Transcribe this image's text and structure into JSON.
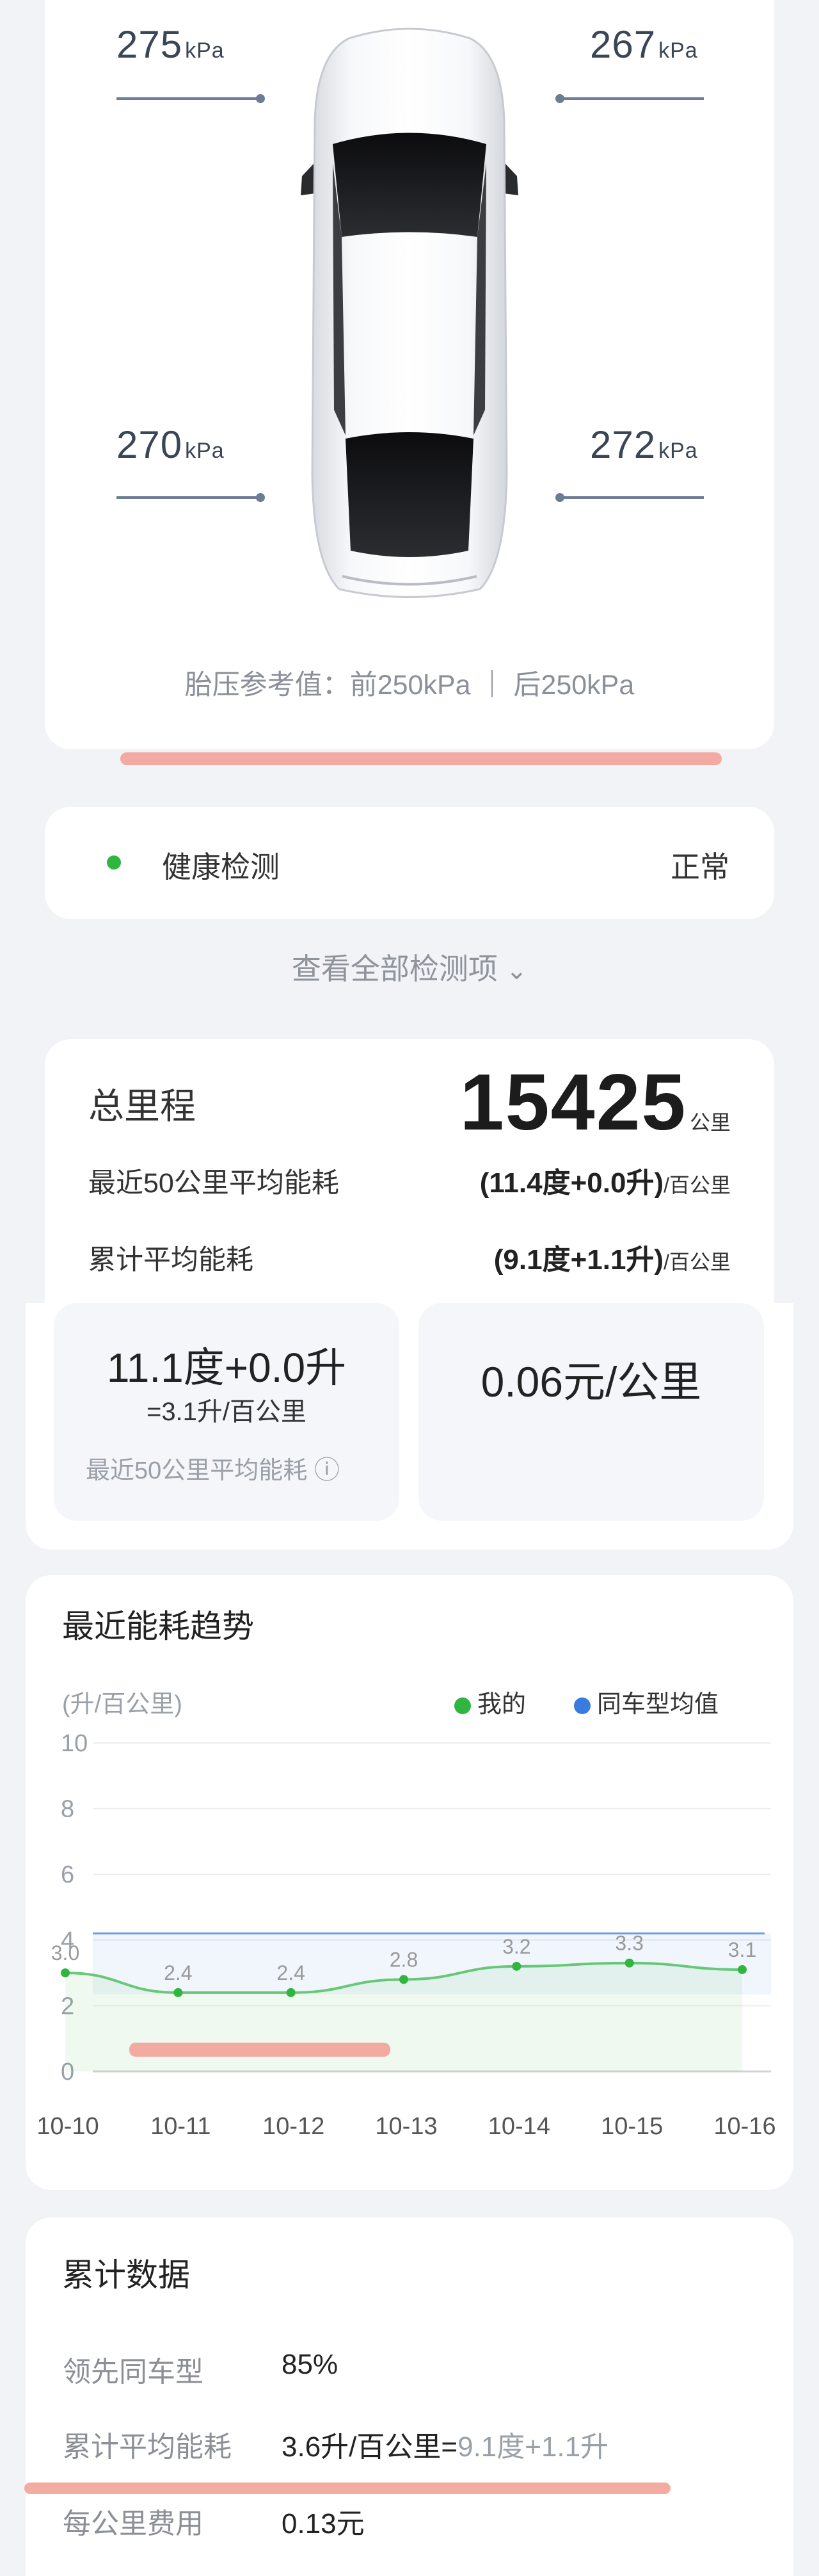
{
  "tire_pressure": {
    "front_left": "275",
    "front_right": "267",
    "rear_left": "270",
    "rear_right": "272",
    "unit": "kPa",
    "reference_text": "胎压参考值：前250kPa ｜ 后250kPa"
  },
  "health": {
    "label": "健康检测",
    "status": "正常",
    "status_color": "#2fb540"
  },
  "view_all": {
    "label": "查看全部检测项",
    "chevron": "⌄"
  },
  "mileage": {
    "total_label": "总里程",
    "total_value": "15425",
    "total_unit": "公里",
    "recent_label": "最近50公里平均能耗",
    "recent_value": "(11.4度+0.0升)",
    "recent_unit": "/百公里",
    "cumulative_label": "累计平均能耗",
    "cumulative_value": "(9.1度+1.1升)",
    "cumulative_unit": "/百公里"
  },
  "energy_card": {
    "main": "11.1度+0.0升",
    "sub": "=3.1升/百公里",
    "caption": "最近50公里平均能耗",
    "info_icon": "ⓘ"
  },
  "cost_card": {
    "value": "0.06元/公里"
  },
  "trend": {
    "title": "最近能耗趋势",
    "unit_label": "(升/百公里)",
    "legend_mine": "我的",
    "legend_avg": "同车型均值",
    "mine_color": "#2fb540",
    "avg_color": "#3a7be0"
  },
  "chart_data": {
    "type": "line",
    "x": [
      "10-10",
      "10-11",
      "10-12",
      "10-13",
      "10-14",
      "10-15",
      "10-16"
    ],
    "ylim": [
      0,
      10
    ],
    "yticks": [
      0,
      2,
      4,
      6,
      8,
      10
    ],
    "ylabel": "(升/百公里)",
    "series": [
      {
        "name": "我的",
        "values": [
          3.0,
          2.4,
          2.4,
          2.8,
          3.2,
          3.3,
          3.1
        ],
        "labels": [
          "3.0",
          "2.4",
          "2.4",
          "2.8",
          "3.2",
          "3.3",
          "3.1"
        ],
        "color": "#2fb540"
      },
      {
        "name": "同车型均值",
        "values": [
          4.2,
          4.2,
          4.2,
          4.2,
          4.2,
          4.2,
          4.2
        ],
        "color": "#3a7be0"
      }
    ],
    "legend": "top-right",
    "grid": true
  },
  "cumulative": {
    "title": "累计数据",
    "rows": [
      {
        "label": "领先同车型",
        "value": "85%"
      },
      {
        "label": "累计平均能耗",
        "value": "3.6升/百公里=",
        "value_extra": "9.1度+1.1升"
      },
      {
        "label": "每公里费用",
        "value": "0.13元"
      }
    ]
  }
}
